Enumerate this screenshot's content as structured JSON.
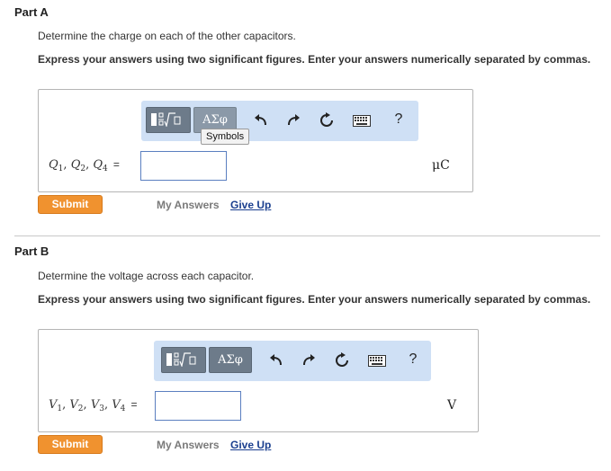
{
  "part_a": {
    "title": "Part A",
    "instruction": "Determine the charge on each of the other capacitors.",
    "format_note": "Express your answers using two significant figures. Enter your answers numerically separated by commas.",
    "toolbar": {
      "greek_label": "ΑΣφ",
      "tooltip": "Symbols",
      "help_label": "?"
    },
    "variables": [
      {
        "sym": "Q",
        "sub": "1"
      },
      {
        "sym": "Q",
        "sub": "2"
      },
      {
        "sym": "Q",
        "sub": "4"
      }
    ],
    "separator": ",",
    "equals": "=",
    "input_value": "",
    "unit": "μC",
    "submit_label": "Submit",
    "my_answers_label": "My Answers",
    "give_up_label": "Give Up"
  },
  "part_b": {
    "title": "Part B",
    "instruction": "Determine the voltage across each capacitor.",
    "format_note": "Express your answers using two significant figures. Enter your answers numerically separated by commas.",
    "toolbar": {
      "greek_label": "ΑΣφ",
      "help_label": "?"
    },
    "variables": [
      {
        "sym": "V",
        "sub": "1"
      },
      {
        "sym": "V",
        "sub": "2"
      },
      {
        "sym": "V",
        "sub": "3"
      },
      {
        "sym": "V",
        "sub": "4"
      }
    ],
    "separator": ",",
    "equals": "=",
    "input_value": "",
    "unit": "V",
    "submit_label": "Submit",
    "my_answers_label": "My Answers",
    "give_up_label": "Give Up"
  },
  "colors": {
    "submit": "#f0922f",
    "toolbar_bg": "#cfe0f5",
    "link": "#1b3f8f",
    "input_border": "#5b7fc0"
  },
  "icons": [
    "fraction-root-icon",
    "undo-icon",
    "redo-icon",
    "reset-icon",
    "keyboard-icon",
    "help-icon"
  ]
}
